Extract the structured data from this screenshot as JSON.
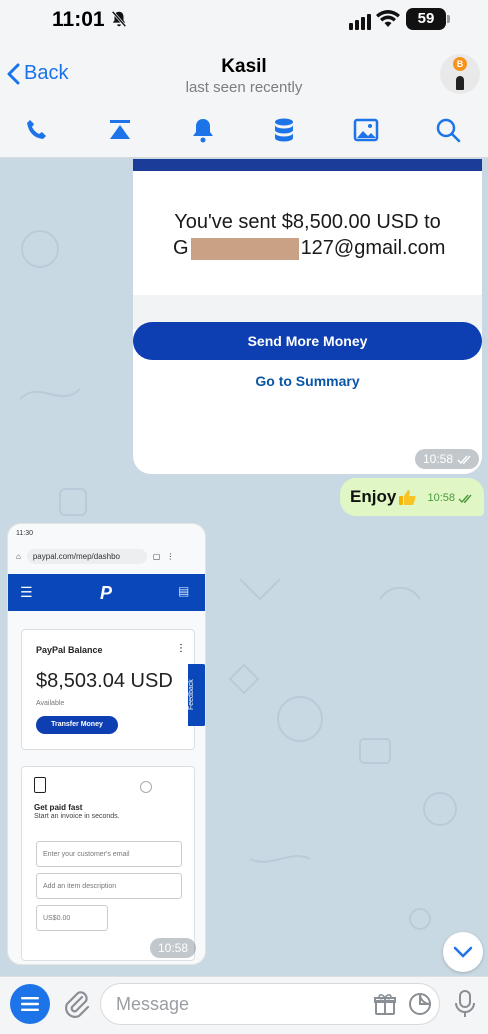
{
  "status_bar": {
    "time": "11:01",
    "battery": "59"
  },
  "header": {
    "back_label": "Back",
    "contact_name": "Kasil",
    "last_seen": "last seen recently",
    "avatar_badge": "B"
  },
  "messages": {
    "paypal_card": {
      "line1": "You've sent $8,500.00 USD to",
      "email_prefix": "G",
      "email_suffix": "127@gmail.com",
      "send_more": "Send More Money",
      "go_summary": "Go to Summary",
      "time": "10:58"
    },
    "enjoy": {
      "text": "Enjoy",
      "time": "10:58"
    },
    "screenshot": {
      "status_time": "11:30",
      "url": "paypal.com/mep/dashbo",
      "logo": "P",
      "balance_title": "PayPal Balance",
      "balance_amount": "$8,503.04 USD",
      "available": "Available",
      "transfer": "Transfer Money",
      "feedback": "Feedback",
      "get_paid": "Get paid fast",
      "get_paid_sub": "Start an invoice in seconds.",
      "field_email": "Enter your customer's email",
      "field_desc": "Add an item description",
      "field_amount": "US$0.00",
      "time": "10:58"
    }
  },
  "input": {
    "placeholder": "Message"
  },
  "colors": {
    "accent": "#1d74e8",
    "outgoing_bubble": "#e0f7c5",
    "paypal_blue": "#0d3fb3"
  }
}
